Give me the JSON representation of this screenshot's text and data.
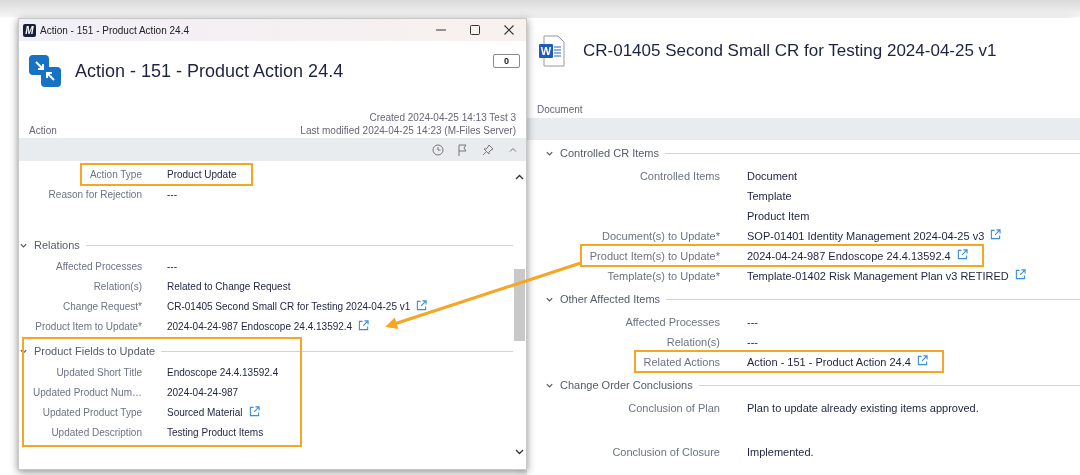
{
  "left_window": {
    "app_logo": "M",
    "title_bar": "Action - 151 - Product Action 24.4",
    "comment_count": "0",
    "title": "Action - 151 - Product Action 24.4",
    "object_class": "Action",
    "created": "Created 2024-04-25 14:13 Test 3",
    "modified": "Last modified 2024-04-25 14:23 (M-Files Server)",
    "properties": [
      {
        "label": "Action Type",
        "values": [
          {
            "text": "Product Update",
            "link": false
          }
        ],
        "highlighted": true
      },
      {
        "label": "Reason for Rejection",
        "values": [
          {
            "text": "---",
            "link": false
          }
        ],
        "highlighted": false
      }
    ],
    "sections": [
      {
        "title": "Relations",
        "expanded": true,
        "highlighted": false,
        "rows": [
          {
            "label": "Affected Processes",
            "values": [
              {
                "text": "---",
                "link": false
              }
            ],
            "highlighted": false
          },
          {
            "label": "Relation(s)",
            "values": [
              {
                "text": "Related to Change Request",
                "link": false
              }
            ],
            "highlighted": false
          },
          {
            "label": "Change Request*",
            "values": [
              {
                "text": "CR-01405 Second Small CR for Testing 2024-04-25 v1",
                "link": true
              }
            ],
            "highlighted": false
          },
          {
            "label": "Product Item to Update*",
            "values": [
              {
                "text": "2024-04-24-987 Endoscope 24.4.13592.4",
                "link": true
              }
            ],
            "highlighted": false,
            "arrow_to": true
          }
        ]
      },
      {
        "title": "Product Fields to Update",
        "expanded": true,
        "highlighted": true,
        "rows": [
          {
            "label": "Updated Short Title",
            "values": [
              {
                "text": "Endoscope 24.4.13592.4",
                "link": false
              }
            ],
            "highlighted": false
          },
          {
            "label": "Updated Product Num…",
            "values": [
              {
                "text": "2024-04-24-987",
                "link": false
              }
            ],
            "highlighted": false
          },
          {
            "label": "Updated Product Type",
            "values": [
              {
                "text": "Sourced Material",
                "link": true
              }
            ],
            "highlighted": false
          },
          {
            "label": "Updated Description",
            "values": [
              {
                "text": "Testing Product Items",
                "link": false
              }
            ],
            "highlighted": false
          }
        ]
      }
    ]
  },
  "right_panel": {
    "doc_icon_letter": "W",
    "title": "CR-01405 Second Small CR for Testing 2024-04-25 v1",
    "object_class": "Document",
    "sections": [
      {
        "title": "Controlled CR Items",
        "expanded": true,
        "highlighted": false,
        "rows": [
          {
            "label": "Controlled Items",
            "values": [
              {
                "text": "Document",
                "link": false
              },
              {
                "text": "Template",
                "link": false
              },
              {
                "text": "Product Item",
                "link": false
              }
            ],
            "highlighted": false
          },
          {
            "label": "Document(s) to Update*",
            "values": [
              {
                "text": "SOP-01401 Identity Management 2024-04-25 v3",
                "link": true
              }
            ],
            "highlighted": false
          },
          {
            "label": "Product Item(s) to Update*",
            "values": [
              {
                "text": "2024-04-24-987 Endoscope 24.4.13592.4",
                "link": true
              }
            ],
            "highlighted": true,
            "arrow_from": true
          },
          {
            "label": "Template(s) to Update*",
            "values": [
              {
                "text": "Template-01402 Risk Management Plan v3 RETIRED",
                "link": true
              }
            ],
            "highlighted": false
          }
        ]
      },
      {
        "title": "Other Affected Items",
        "expanded": true,
        "highlighted": false,
        "rows": [
          {
            "label": "Affected Processes",
            "values": [
              {
                "text": "---",
                "link": false
              }
            ],
            "highlighted": false
          },
          {
            "label": "Relation(s)",
            "values": [
              {
                "text": "---",
                "link": false
              }
            ],
            "highlighted": false
          },
          {
            "label": "Related Actions",
            "values": [
              {
                "text": "Action - 151 - Product Action 24.4",
                "link": true
              }
            ],
            "highlighted": true
          }
        ]
      },
      {
        "title": "Change Order Conclusions",
        "expanded": true,
        "highlighted": false,
        "rows": [
          {
            "label": "Conclusion of Plan",
            "values": [
              {
                "text": "Plan to update already existing items approved.",
                "link": false
              }
            ],
            "highlighted": false,
            "multiline": true
          },
          {
            "label": "Conclusion of Closure",
            "values": [
              {
                "text": "Implemented.",
                "link": false
              }
            ],
            "highlighted": false,
            "multiline": false
          }
        ]
      }
    ]
  }
}
